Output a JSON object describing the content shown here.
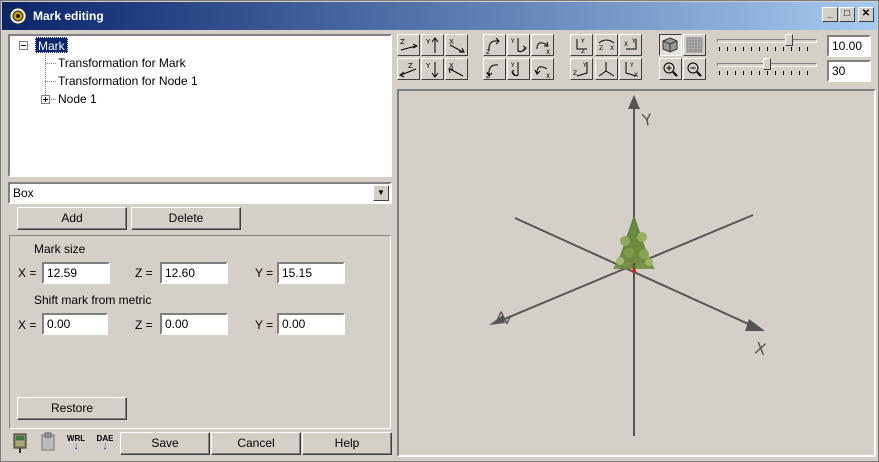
{
  "window": {
    "title": "Mark editing"
  },
  "tree": {
    "items": [
      {
        "label": "Mark",
        "selected": true
      },
      {
        "label": "Transformation for Mark"
      },
      {
        "label": "Transformation for Node 1"
      },
      {
        "label": "Node 1"
      }
    ]
  },
  "shape_select": {
    "value": "Box"
  },
  "buttons": {
    "add": "Add",
    "delete": "Delete",
    "restore": "Restore",
    "save": "Save",
    "cancel": "Cancel",
    "help": "Help"
  },
  "mark_size": {
    "heading": "Mark size",
    "x_label": "X =",
    "x_value": "12.59",
    "z_label": "Z =",
    "z_value": "12.60",
    "y_label": "Y =",
    "y_value": "15.15"
  },
  "shift": {
    "heading": "Shift mark from metric",
    "x_label": "X =",
    "x_value": "0.00",
    "z_label": "Z =",
    "z_value": "0.00",
    "y_label": "Y =",
    "y_value": "0.00"
  },
  "view_controls": {
    "value_top": "10.00",
    "value_bottom": "30",
    "slider_top_level": 0.72,
    "slider_bottom_level": 0.5
  },
  "axes": {
    "y": "Y",
    "z": "Z",
    "x": "X"
  },
  "bottom_icons": [
    "tree-icon",
    "clipboard-icon",
    "wrl-export-icon",
    "dae-export-icon"
  ],
  "bottom_icon_labels": {
    "wrl": "WRL",
    "dae": "DAE"
  },
  "colors": {
    "titlebar_start": "#0a246a",
    "titlebar_end": "#a6caf0",
    "face": "#d4d0c8",
    "selection": "#0a246a"
  }
}
